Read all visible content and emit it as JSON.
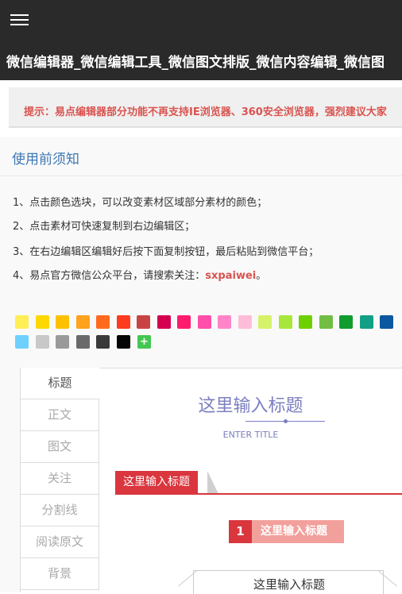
{
  "header": {
    "menu_icon": "hamburger-menu-icon",
    "title": "微信编辑器_微信编辑工具_微信图文排版_微信内容编辑_微信图"
  },
  "notice": {
    "text": "提示：易点编辑器部分功能不再支持IE浏览器、360安全浏览器，强烈建议大家"
  },
  "guide": {
    "title": "使用前须知",
    "items": [
      "1、点击颜色选块，可以改变素材区域部分素材的颜色；",
      "2、点击素材可快速复制到右边编辑区；",
      "3、在右边编辑区编辑好后按下面复制按钮，最后粘贴到微信平台；",
      "4、易点官方微信公众平台，请搜索关注："
    ],
    "wechat_id": "sxpaiwei",
    "wechat_suffix": "。"
  },
  "colors": {
    "row1": [
      "#ffee55",
      "#ffd800",
      "#ffc000",
      "#ffa21e",
      "#ff6a1e",
      "#ff3b1e",
      "#c84444",
      "#d4004f",
      "#ff1c6e",
      "#ff4faa",
      "#ff85c8",
      "#ffbcd8",
      "#d6f26a",
      "#a8e63c",
      "#6ed000",
      "#72be44",
      "#119c2e",
      "#11a085",
      "#0b57a0"
    ],
    "row2": [
      "#6ed0ff",
      "#c8c8c8",
      "#9a9a9a",
      "#6a6a6a",
      "#3a3a3a",
      "#050505"
    ],
    "add_label": "+",
    "add_color": "#44c752"
  },
  "tabs": [
    "标题",
    "正文",
    "图文",
    "关注",
    "分割线",
    "阅读原文",
    "背景"
  ],
  "preview": {
    "title1": "这里输入标题",
    "title1_sub": "ENTER TITLE",
    "title2": "这里输入标题",
    "title3_num": "1",
    "title3": "这里输入标题",
    "title4": "这里输入标题"
  }
}
